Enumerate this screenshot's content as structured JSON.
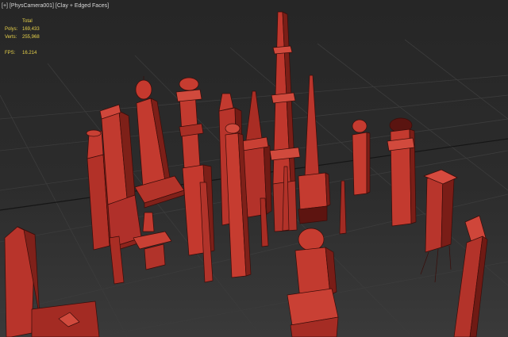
{
  "viewport": {
    "label_plus": "[+]",
    "label_camera": "[PhysCamera001]",
    "label_shading": "[Clay + Edged Faces]",
    "stats": {
      "header": "Total",
      "polys_label": "Polys:",
      "polys_value": "169,433",
      "verts_label": "Verts:",
      "verts_value": "255,968",
      "fps_label": "FPS:",
      "fps_value": "16.214"
    }
  },
  "colors": {
    "background": "#2a2a2a",
    "grid": "#3f3f3f",
    "clay": "#b8352c",
    "clay_dark": "#6e1a15",
    "clay_light": "#d64a3e",
    "edge": "#3a0c09",
    "stats_text": "#e8d24a",
    "label_text": "#d8d8d8"
  }
}
